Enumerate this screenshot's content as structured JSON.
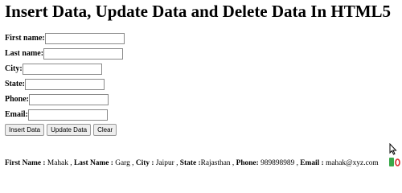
{
  "page": {
    "title": "Insert Data, Update Data and Delete Data In HTML5"
  },
  "form": {
    "fields": [
      {
        "label": "First name:",
        "value": ""
      },
      {
        "label": "Last name:",
        "value": ""
      },
      {
        "label": "City:",
        "value": ""
      },
      {
        "label": "State:",
        "value": ""
      },
      {
        "label": "Phone:",
        "value": ""
      },
      {
        "label": "Email:",
        "value": ""
      }
    ],
    "buttons": {
      "insert": "Insert Data",
      "update": "Update Data",
      "clear": "Clear"
    }
  },
  "output": {
    "first_name_label": "First Name :",
    "first_name": "Mahak",
    "last_name_label": "Last Name :",
    "last_name": "Garg",
    "city_label": "City :",
    "city": "Jaipur",
    "state_label": "State :",
    "state": "Rajasthan",
    "phone_label": "Phone:",
    "phone": "989898989",
    "email_label": "Email :",
    "email": "mahak@xyz.com"
  },
  "icons": {
    "cursor": "mouse-pointer-icon",
    "tray_green": "green-tray-icon",
    "tray_red": "red-tray-icon"
  }
}
